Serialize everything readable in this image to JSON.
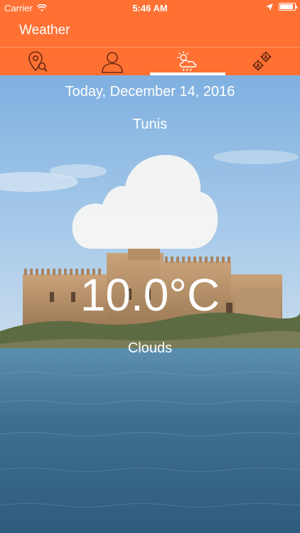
{
  "status_bar": {
    "carrier": "Carrier",
    "time": "5:46 AM",
    "battery_level": 0.9
  },
  "app": {
    "title": "Weather",
    "accent_color": "#ff7133"
  },
  "tabs": [
    {
      "icon": "location-search-icon",
      "active": false
    },
    {
      "icon": "user-icon",
      "active": false
    },
    {
      "icon": "weather-icon",
      "active": true
    },
    {
      "icon": "settings-gears-icon",
      "active": false
    }
  ],
  "weather": {
    "date": "Today, December 14, 2016",
    "city": "Tunis",
    "temperature": "10.0°C",
    "condition": "Clouds",
    "icon": "cloud-icon"
  }
}
